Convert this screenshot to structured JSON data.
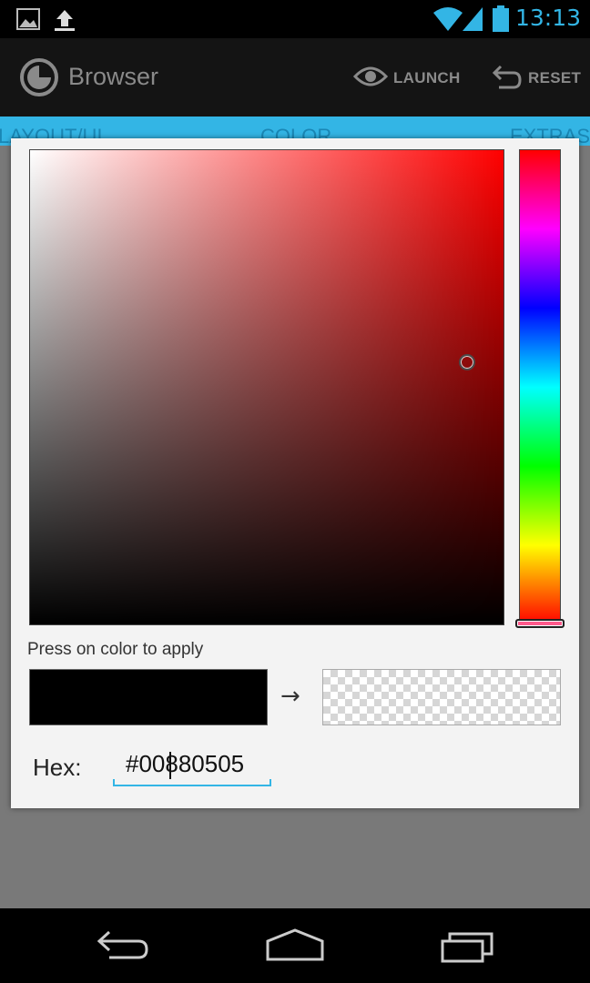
{
  "status_bar": {
    "time": "13:13",
    "left_icons": [
      "image-icon",
      "upload-icon"
    ],
    "right_icons": [
      "wifi-icon",
      "signal-icon",
      "battery-icon"
    ]
  },
  "action_bar": {
    "title": "Browser",
    "actions": [
      {
        "label": "LAUNCH",
        "icon": "eye-icon"
      },
      {
        "label": "RESET",
        "icon": "undo-icon"
      }
    ]
  },
  "tabs": [
    "LAYOUT/UI",
    "COLOR",
    "EXTRAS"
  ],
  "color_picker": {
    "hint": "Press on color to apply",
    "arrow": "→",
    "hex_label": "Hex:",
    "hex_value": "#00880505",
    "old_color": "#000000",
    "hue": "#ff0000"
  },
  "colors": {
    "accent": "#33b5e5",
    "dialog_bg": "#f3f3f3",
    "action_bar_bg": "#141414"
  }
}
